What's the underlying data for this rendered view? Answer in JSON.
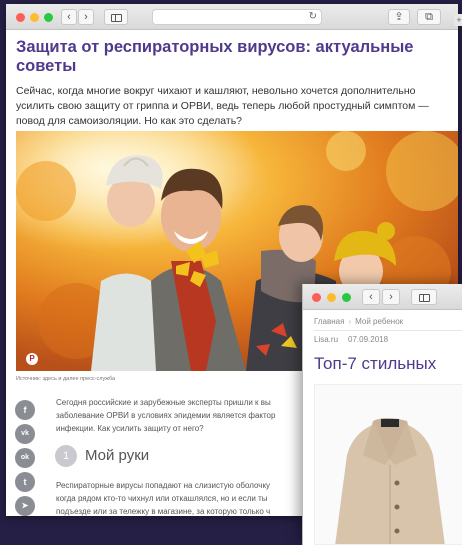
{
  "browser_back": {
    "back_glyph": "‹",
    "forward_glyph": "›",
    "reload_glyph": "↻",
    "share_glyph": "⇪",
    "tabs_glyph": "⧉"
  },
  "article": {
    "title": "Защита от респираторных вирусов: актуальные советы",
    "lead": "Сейчас, когда многие вокруг чихают и кашляют, невольно хочется дополнительно усилить свою защиту от гриппа и ОРВИ, ведь теперь любой простудный симптом — повод для самоизоляции. Но как это сделать?",
    "pin_glyph": "P",
    "photo_caption": "Источник: здесь и далее пресс-служба",
    "share_icons": [
      {
        "name": "facebook-icon",
        "glyph": "f"
      },
      {
        "name": "vk-icon",
        "glyph": "vk"
      },
      {
        "name": "odnoklassniki-icon",
        "glyph": "ok"
      },
      {
        "name": "twitter-icon",
        "glyph": "t"
      },
      {
        "name": "telegram-icon",
        "glyph": "➤"
      }
    ],
    "paragraph1": [
      "Сегодня российские и зарубежные эксперты пришли к вы",
      "заболевание ОРВИ в условиях эпидемии является фактор",
      "инфекции. Как усилить защиту от него?"
    ],
    "section_number": "1",
    "section_title": "Мой руки",
    "paragraph2": [
      "Респираторные вирусы попадают на слизистую оболочку",
      "когда рядом кто-то чихнул или откашлялся, но и если ты",
      "подъезде или за тележку в магазине, за которую только ч"
    ]
  },
  "front_window": {
    "breadcrumb_home": "Главная",
    "breadcrumb_sep": "›",
    "breadcrumb_section": "Мой ребенок",
    "source": "Lisa.ru",
    "date": "07.09.2018",
    "title": "Топ-7 стильных"
  },
  "colors": {
    "title": "#4f3a8c",
    "desktop": "#261f45"
  }
}
